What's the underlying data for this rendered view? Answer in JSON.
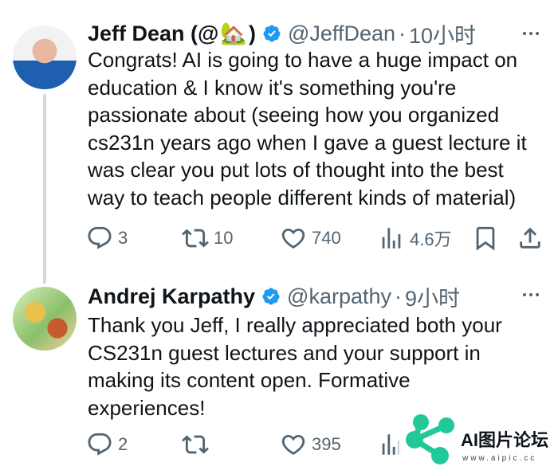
{
  "colors": {
    "text": "#0f1419",
    "secondary": "#536471",
    "verified": "#1d9bf0",
    "thread_line": "#cfd9de",
    "brand": "#20c997"
  },
  "tweets": [
    {
      "name": "Jeff Dean (@",
      "emoji": "🏡",
      "name_suffix": ")",
      "handle": "@JeffDean",
      "dot": "·",
      "time": "10小时",
      "text": "Congrats! AI is going to have a huge impact on\neducation & I know it's something you're\npassionate about (seeing how you organized\ncs231n years ago when I gave a guest lecture it\nwas clear you put lots of thought into the best\nway to teach people different kinds of material)",
      "replies": "3",
      "retweets": "10",
      "likes": "740",
      "views": "4.6万"
    },
    {
      "name": "Andrej Karpathy",
      "emoji": "",
      "name_suffix": "",
      "handle": "@karpathy",
      "dot": "·",
      "time": "9小时",
      "text": "Thank you Jeff, I really appreciated both your\nCS231n guest lectures and your support in\nmaking its content open. Formative\nexperiences!",
      "replies": "2",
      "retweets": "",
      "likes": "395",
      "views": ""
    }
  ],
  "watermark": {
    "text": "AI图片论坛",
    "url": "www.aipic.cc"
  }
}
